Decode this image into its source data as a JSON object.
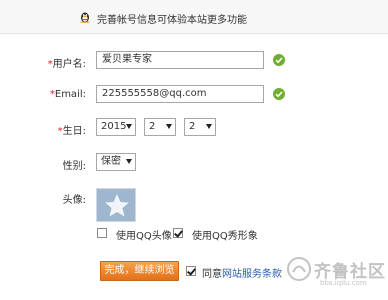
{
  "notice": {
    "icon": "qq-penguin-icon",
    "text": "完善帐号信息可体验本站更多功能"
  },
  "form": {
    "username": {
      "required_mark": "*",
      "label": "用户名:",
      "value": "爱贝果专家",
      "status_icon": "check-circle-icon"
    },
    "email": {
      "required_mark": "*",
      "label": "Email:",
      "value": "225555558@qq.com",
      "status_icon": "check-circle-icon"
    },
    "birthday": {
      "required_mark": "*",
      "label": "生日:",
      "year": "2015",
      "month": "2",
      "day": "2"
    },
    "gender": {
      "label": "性别:",
      "value": "保密"
    },
    "avatar": {
      "label": "头像:",
      "use_qq_avatar": {
        "label": "使用QQ头像",
        "checked": false
      },
      "use_qq_show": {
        "label": "使用QQ秀形象",
        "checked": true
      }
    },
    "submit_label": "完成，继续浏览",
    "agree": {
      "checked": true,
      "prefix": "同意",
      "link": "网站服务条款"
    }
  },
  "watermark": {
    "text": "齐鲁社区",
    "url": "bbs.iqilu.com"
  },
  "colors": {
    "accent": "#e2701a",
    "ok": "#6fae2e",
    "required": "#dd2222",
    "link": "#2a5db0"
  }
}
